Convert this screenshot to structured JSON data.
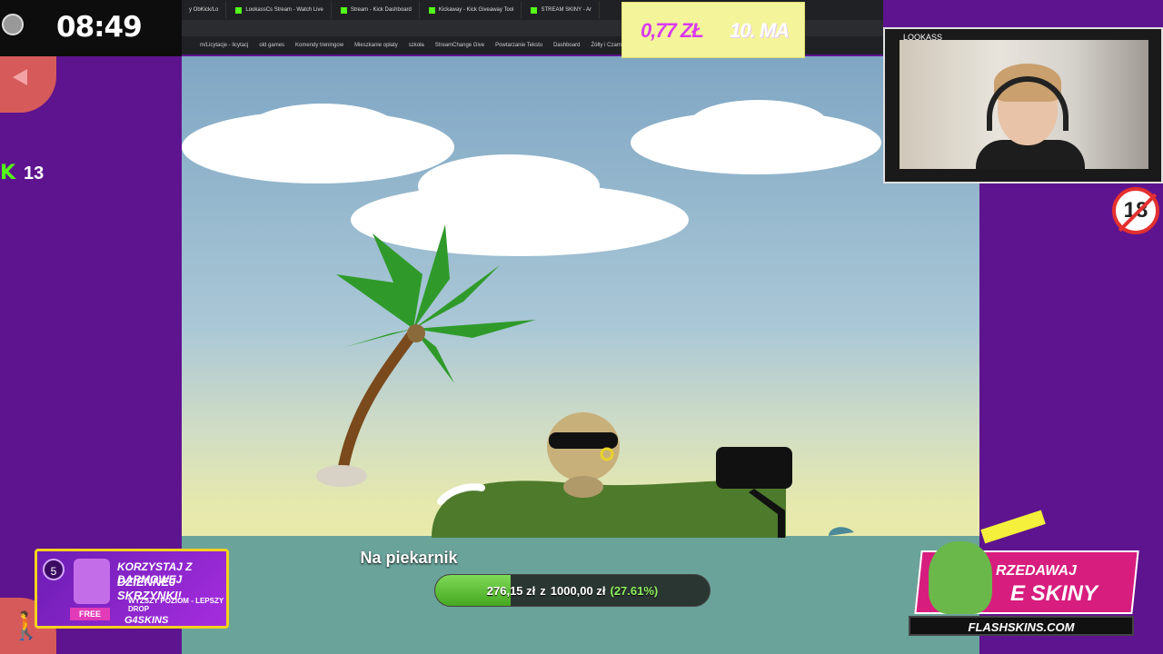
{
  "timer": {
    "time": "08:49"
  },
  "left_panel": {
    "viewer_count": "13",
    "kick_glyph": "K"
  },
  "stats": {
    "money": "0,77 ZŁ",
    "subs": "10. MA"
  },
  "webcam": {
    "name": "LOOKASS"
  },
  "age_badge": {
    "label": "18"
  },
  "browser": {
    "tabs": [
      "y ObKick/Lo",
      "LookassCs Stream - Watch Live",
      "Stream - Kick Dashboard",
      "Kickaway - Kick Giveaway Tool",
      "STREAM SKINY - Ar"
    ],
    "bookmarks": [
      "m/Licytacje - licytacj",
      "old games",
      "Komendy treningow",
      "Mieszkanie opłaty",
      "szkoła",
      "StreamChange Give",
      "Powtarzanie Tekstu",
      "Dashboard",
      "Żółty i Czarny T"
    ]
  },
  "goal": {
    "title": "Na piekarnik",
    "current": "276,15 zł",
    "connector": "z",
    "target": "1000,00 zł",
    "percent_label": "(27.61%)",
    "progress": 0.2761
  },
  "promo_left": {
    "level": "5",
    "line1": "KORZYSTAJ Z DARMOWEJ",
    "line2": "DZIENNEJ SKRZYNKI!",
    "line3": "WYŻSZY POZIOM - LEPSZY DROP",
    "free": "FREE",
    "brand": "G4SKINS"
  },
  "promo_right": {
    "line1": "RZEDAWAJ",
    "line2": "E SKINY",
    "brand": "FLASHSKINS.COM"
  },
  "colors": {
    "accent_purple": "#5e148e",
    "kick_green": "#53fc18",
    "goal_fill": "#45a820"
  }
}
